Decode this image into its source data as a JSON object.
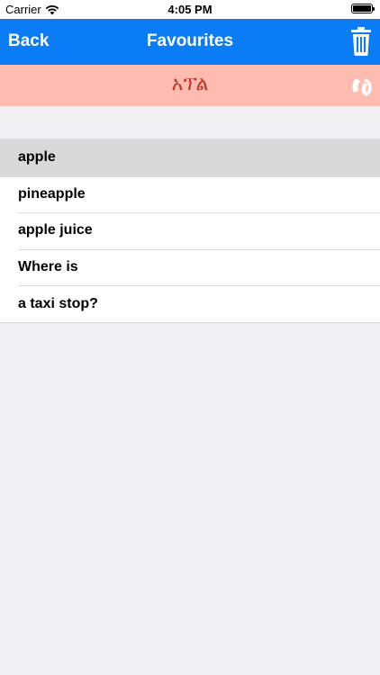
{
  "status": {
    "carrier": "Carrier",
    "time": "4:05 PM"
  },
  "nav": {
    "back_label": "Back",
    "title": "Favourites"
  },
  "banner": {
    "text": "አፕል"
  },
  "favourites": [
    {
      "label": "apple",
      "selected": true
    },
    {
      "label": "pineapple",
      "selected": false
    },
    {
      "label": "apple juice",
      "selected": false
    },
    {
      "label": "Where is",
      "selected": false
    },
    {
      "label": "a taxi stop?",
      "selected": false
    }
  ],
  "colors": {
    "nav_bg": "#0a7cf5",
    "banner_bg": "#ffbbb0",
    "banner_text": "#c0392b",
    "selected_row": "#d9d9d9",
    "background": "#efeff4"
  },
  "icons": {
    "wifi": "wifi-icon",
    "battery": "battery-icon",
    "trash": "trash-icon",
    "speak": "speak-icon"
  }
}
